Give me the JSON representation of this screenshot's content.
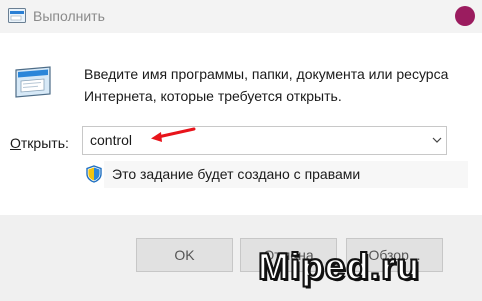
{
  "window": {
    "title": "Выполнить",
    "app_icon": "run-dialog-icon",
    "control_dot_color": "#9b1c5f"
  },
  "dialog": {
    "description": "Введите имя программы, папки, документа или ресурса Интернета, которые требуется открыть.",
    "open_label_accel": "О",
    "open_label_rest": "ткрыть:",
    "input_value": "control",
    "admin_note": "Это задание будет создано с правами",
    "annotation_arrow_color": "#e8141b"
  },
  "buttons": {
    "ok": "OK",
    "cancel": "Отмена",
    "browse": "Обзор..."
  },
  "watermark": "Miped.ru"
}
